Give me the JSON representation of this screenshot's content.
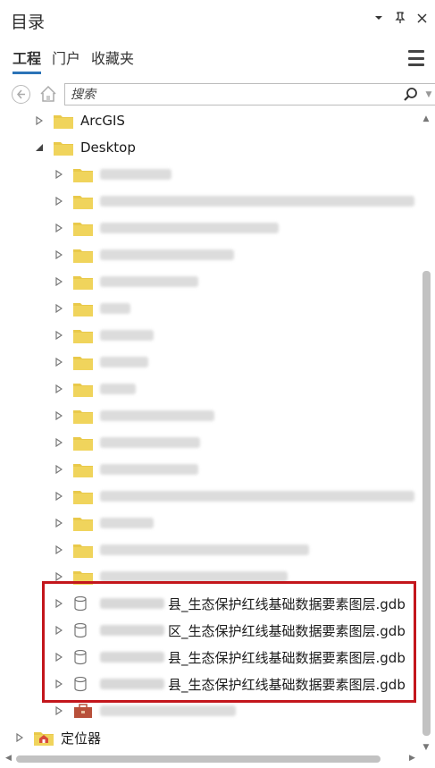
{
  "panel": {
    "title": "目录"
  },
  "tabs": [
    {
      "label": "工程",
      "active": true
    },
    {
      "label": "门户",
      "active": false
    },
    {
      "label": "收藏夹",
      "active": false
    }
  ],
  "search": {
    "placeholder": "搜索"
  },
  "tree": {
    "top_items": [
      {
        "label": "ArcGIS",
        "expanded": false
      },
      {
        "label": "Desktop",
        "expanded": true
      }
    ],
    "blurred_folder_count": 16,
    "gdb_items": [
      {
        "label": "县_生态保护红线基础数据要素图层.gdb"
      },
      {
        "label": "区_生态保护红线基础数据要素图层.gdb"
      },
      {
        "label": "县_生态保护红线基础数据要素图层.gdb"
      },
      {
        "label": "县_生态保护红线基础数据要素图层.gdb"
      }
    ],
    "locator": {
      "label": "定位器"
    }
  },
  "colors": {
    "folder": "#e9c94a",
    "highlight": "#c3161c",
    "accent": "#2b73b7"
  }
}
